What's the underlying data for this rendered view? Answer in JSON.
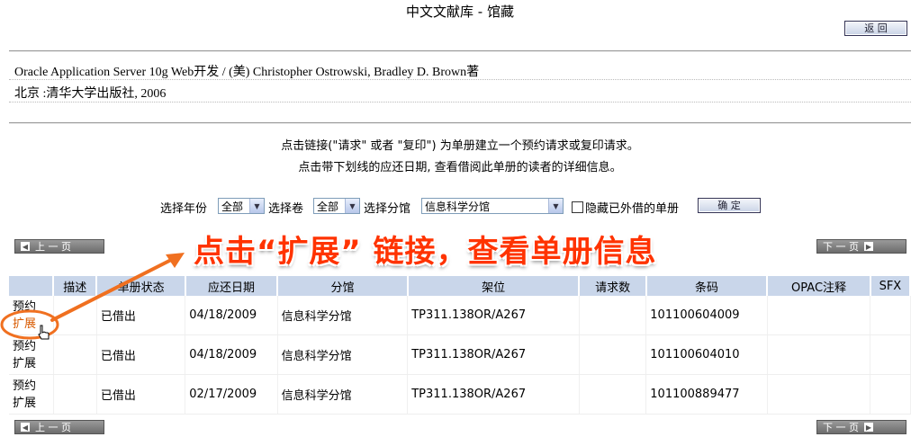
{
  "page": {
    "title": "中文文献库 - 馆藏",
    "back_label": "返 回"
  },
  "record": {
    "title_line": "Oracle Application Server 10g Web开发  / (美) Christopher Ostrowski, Bradley D. Brown著",
    "publisher_line": "北京 :清华大学出版社, 2006"
  },
  "instructions": {
    "line1": "点击链接(\"请求\" 或者  \"复印\") 为单册建立一个预约请求或复印请求。",
    "line2": "点击带下划线的应还日期,    查看借阅此单册的读者的详细信息。"
  },
  "filters": {
    "year_label": "选择年份",
    "year_value": "全部",
    "volume_label": "选择卷",
    "volume_value": "全部",
    "branch_label": "选择分馆",
    "branch_value": "信息科学分馆",
    "hide_label": "隐藏已外借的单册",
    "confirm_label": "确 定"
  },
  "nav": {
    "prev_label": "上 一 页",
    "next_label": "下 一 页"
  },
  "annotation": {
    "banner": "点击“扩展” 链接，查看单册信息",
    "arrow_color": "#f07020"
  },
  "table": {
    "headers": [
      "",
      "描述",
      "单册状态",
      "应还日期",
      "分馆",
      "架位",
      "请求数",
      "条码",
      "OPAC注释",
      "SFX"
    ],
    "rows": [
      {
        "link1": "预约",
        "link2": "扩展",
        "description": "",
        "status": "已借出",
        "due": "04/18/2009",
        "branch": "信息科学分馆",
        "shelf": "TP311.138OR/A267",
        "requests": "",
        "barcode": "101100604009",
        "opac_note": "",
        "sfx": ""
      },
      {
        "link1": "预约",
        "link2": "扩展",
        "description": "",
        "status": "已借出",
        "due": "04/18/2009",
        "branch": "信息科学分馆",
        "shelf": "TP311.138OR/A267",
        "requests": "",
        "barcode": "101100604010",
        "opac_note": "",
        "sfx": ""
      },
      {
        "link1": "预约",
        "link2": "扩展",
        "description": "",
        "status": "已借出",
        "due": "02/17/2009",
        "branch": "信息科学分馆",
        "shelf": "TP311.138OR/A267",
        "requests": "",
        "barcode": "101100889477",
        "opac_note": "",
        "sfx": ""
      }
    ]
  },
  "colors": {
    "header_bg": "#c9d6ea",
    "banner_text": "#ff3300",
    "link_highlight": "#d85a00"
  }
}
